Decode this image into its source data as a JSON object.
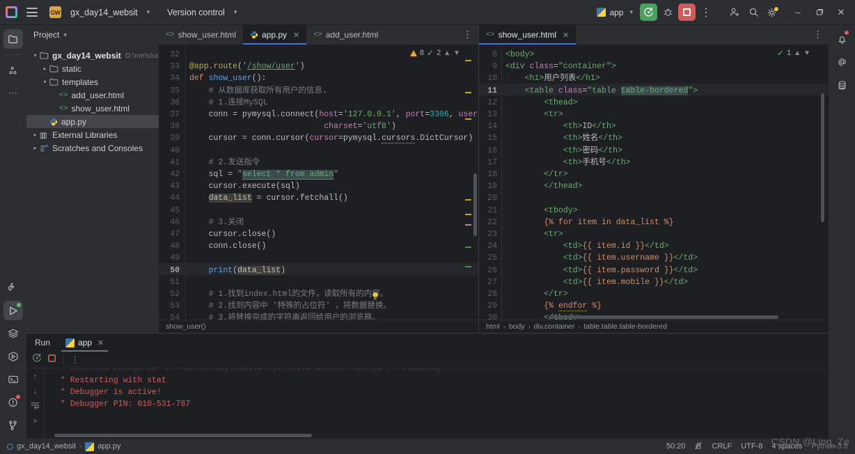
{
  "titlebar": {
    "project_badge": "GW",
    "project_name": "gx_day14_websit",
    "version_control": "Version control",
    "run_config": "app",
    "icons": {
      "menu": "hamburger-icon",
      "run": "run-icon",
      "debug": "debug-icon",
      "stop": "stop-icon",
      "more": "more-vertical-icon",
      "account": "user-add-icon",
      "search": "search-icon",
      "settings": "gear-icon",
      "minimize": "minimize-icon",
      "maximize": "maximize-icon",
      "close": "close-icon"
    }
  },
  "left_rail": [
    {
      "name": "project-tool-icon",
      "selected": true
    },
    {
      "name": "commit-tool-icon",
      "selected": false
    },
    {
      "name": "more-tools-icon",
      "selected": false
    },
    {
      "name": "python-packages-icon",
      "selected": false
    },
    {
      "name": "run-tool-icon",
      "selected": true,
      "badge": "green"
    },
    {
      "name": "database-layers-icon",
      "selected": false
    },
    {
      "name": "python-console-icon",
      "selected": false
    },
    {
      "name": "terminal-icon",
      "selected": false
    },
    {
      "name": "problems-icon",
      "selected": false,
      "badge": "red"
    },
    {
      "name": "version-control-icon",
      "selected": false
    }
  ],
  "right_rail": [
    {
      "name": "notifications-icon",
      "badge": "red"
    },
    {
      "name": "ai-assistant-icon"
    },
    {
      "name": "database-icon"
    }
  ],
  "project_panel": {
    "title": "Project",
    "tree": [
      {
        "indent": 0,
        "arrow": "v",
        "icon": "folder-icon",
        "label": "gx_day14_websit",
        "bold": true,
        "path": "D:\\me\\stud",
        "selected": false
      },
      {
        "indent": 1,
        "arrow": ">",
        "icon": "folder-icon",
        "label": "static",
        "bold": false,
        "path": "",
        "selected": false
      },
      {
        "indent": 1,
        "arrow": "v",
        "icon": "folder-icon",
        "label": "templates",
        "bold": false,
        "path": "",
        "selected": false
      },
      {
        "indent": 2,
        "arrow": "",
        "icon": "html-file-icon",
        "label": "add_user.html",
        "bold": false,
        "path": "",
        "selected": false
      },
      {
        "indent": 2,
        "arrow": "",
        "icon": "html-file-icon",
        "label": "show_user.html",
        "bold": false,
        "path": "",
        "selected": false
      },
      {
        "indent": 1,
        "arrow": "",
        "icon": "python-file-icon",
        "label": "app.py",
        "bold": false,
        "path": "",
        "selected": true
      },
      {
        "indent": 0,
        "arrow": ">",
        "icon": "library-icon",
        "label": "External Libraries",
        "bold": false,
        "path": "",
        "selected": false
      },
      {
        "indent": 0,
        "arrow": ">",
        "icon": "scratches-icon",
        "label": "Scratches and Consoles",
        "bold": false,
        "path": "",
        "selected": false
      }
    ]
  },
  "editor_left": {
    "tabs": [
      {
        "label": "show_user.html",
        "icon": "html-file-icon",
        "active": false,
        "closable": false
      },
      {
        "label": "app.py",
        "icon": "python-file-icon",
        "active": true,
        "closable": true
      },
      {
        "label": "add_user.html",
        "icon": "html-file-icon",
        "active": false,
        "closable": false
      }
    ],
    "inspection": {
      "warnings": "8",
      "checks": "2"
    },
    "breadcrumb": "show_user()",
    "current_line": 50,
    "lines": [
      {
        "no": "32",
        "html": "<span class=\"cm\"></span>"
      },
      {
        "no": "33",
        "html": "<span class=\"dec\">@app</span><span class=\"df\">.</span><span class=\"dec\">route</span><span class=\"df\">(</span><span class=\"st\">'</span><span class=\"underline-url\">/show/user</span><span class=\"st\">'</span><span class=\"df\">)</span>"
      },
      {
        "no": "34",
        "html": "<span class=\"k\">def</span> <span class=\"fn\">show_user</span><span class=\"df\">():</span>"
      },
      {
        "no": "35",
        "html": "    <span class=\"cm\"># 从数据库获取所有用户的信息.</span>"
      },
      {
        "no": "36",
        "html": "    <span class=\"cm\"># 1.连接MySQL</span>"
      },
      {
        "no": "37",
        "html": "    <span class=\"df\">conn = pymysql.connect(</span><span class=\"kw\">host</span><span class=\"df\">=</span><span class=\"st\">'127.0.0.1'</span><span class=\"df\">, </span><span class=\"kw\">port</span><span class=\"df\">=</span><span class=\"nu\">3306</span><span class=\"df\">, </span><span class=\"kw\">user</span><span class=\"df\">=</span><span class=\"st\">'roo</span>"
      },
      {
        "no": "38",
        "html": "                            <span class=\"kw\">charset</span><span class=\"df\">=</span><span class=\"st\">'utf8'</span><span class=\"df\">)</span>"
      },
      {
        "no": "39",
        "html": "    <span class=\"df\">cursor = conn.cursor(</span><span class=\"kw\">cursor</span><span class=\"df\">=pymysql.</span><span class=\"wavy\">cursors</span><span class=\"df\">.DictCursor)</span>"
      },
      {
        "no": "40",
        "html": ""
      },
      {
        "no": "41",
        "html": "    <span class=\"cm\"># 2.发送指令</span>"
      },
      {
        "no": "42",
        "html": "    <span class=\"df\">sql = </span><span class=\"st\">\"</span><span class=\"str-hl st wavy\">select * from admin</span><span class=\"st\">\"</span>"
      },
      {
        "no": "43",
        "html": "    <span class=\"df\">cursor.execute(sql)</span>"
      },
      {
        "no": "44",
        "html": "    <span class=\"occ-hl df\">data_list</span><span class=\"df\"> = cursor.fetchall()</span>"
      },
      {
        "no": "45",
        "html": ""
      },
      {
        "no": "46",
        "html": "    <span class=\"cm\"># 3.关闭</span>"
      },
      {
        "no": "47",
        "html": "    <span class=\"df\">cursor.close()</span>"
      },
      {
        "no": "48",
        "html": "    <span class=\"df\">conn.close()</span>"
      },
      {
        "no": "49",
        "html": ""
      },
      {
        "no": "50",
        "html": "    <span class=\"fn\">print</span><span class=\"df\">(</span><span class=\"occ-hl df\">data_list</span><span class=\"df\">)</span>"
      },
      {
        "no": "51",
        "html": ""
      },
      {
        "no": "52",
        "html": "    <span class=\"cm\"># 1.找到index.html的文件，读取所有的内容。</span>"
      },
      {
        "no": "53",
        "html": "    <span class=\"cm\"># 2.找到内容中 '特殊的占位符' ，将数据替换。</span>"
      },
      {
        "no": "54",
        "html": "    <span class=\"cm\"># 3.将替换完成的字符串返回给用户的浏览器。</span>"
      }
    ]
  },
  "editor_right": {
    "tabs": [
      {
        "label": "show_user.html",
        "icon": "html-file-icon",
        "active": true,
        "closable": true
      }
    ],
    "inspection": {
      "checks": "1"
    },
    "breadcrumb": [
      "html",
      "body",
      "div.container",
      "table.table.table-bordered"
    ],
    "current_line": 11,
    "lines": [
      {
        "no": "8",
        "html": "<span class=\"tg\">&lt;body&gt;</span>"
      },
      {
        "no": "9",
        "html": "<span class=\"tg\">&lt;div </span><span class=\"kw\">class</span><span class=\"df\">=</span><span class=\"st\">\"container\"</span><span class=\"tg\">&gt;</span>"
      },
      {
        "no": "10",
        "html": "    <span class=\"tg\">&lt;h1&gt;</span><span class=\"df\">用户列表</span><span class=\"tg\">&lt;/h1&gt;</span>"
      },
      {
        "no": "11",
        "html": "    <span class=\"tg\">&lt;table </span><span class=\"kw\">class</span><span class=\"df\">=</span><span class=\"st\">\"table </span><span class=\"str-hl st\">table-bordered</span><span class=\"st\">\"</span><span class=\"tg\">&gt;</span>"
      },
      {
        "no": "12",
        "html": "        <span class=\"tg\">&lt;thead&gt;</span>"
      },
      {
        "no": "13",
        "html": "        <span class=\"tg\">&lt;tr&gt;</span>"
      },
      {
        "no": "14",
        "html": "            <span class=\"tg\">&lt;th&gt;</span><span class=\"df\">ID</span><span class=\"tg\">&lt;/th&gt;</span>"
      },
      {
        "no": "15",
        "html": "            <span class=\"tg\">&lt;th&gt;</span><span class=\"df\">姓名</span><span class=\"tg\">&lt;/th&gt;</span>"
      },
      {
        "no": "16",
        "html": "            <span class=\"tg\">&lt;th&gt;</span><span class=\"df\">密码</span><span class=\"tg\">&lt;/th&gt;</span>"
      },
      {
        "no": "17",
        "html": "            <span class=\"tg\">&lt;th&gt;</span><span class=\"df\">手机号</span><span class=\"tg\">&lt;/th&gt;</span>"
      },
      {
        "no": "18",
        "html": "        <span class=\"tg\">&lt;/tr&gt;</span>"
      },
      {
        "no": "19",
        "html": "        <span class=\"tg\">&lt;/thead&gt;</span>"
      },
      {
        "no": "20",
        "html": ""
      },
      {
        "no": "21",
        "html": "        <span class=\"tg\">&lt;tbody&gt;</span>"
      },
      {
        "no": "22",
        "html": "        <span class=\"jj\">{% for item in data_list %}</span>"
      },
      {
        "no": "23",
        "html": "        <span class=\"tg\">&lt;tr&gt;</span>"
      },
      {
        "no": "24",
        "html": "            <span class=\"tg\">&lt;td&gt;</span><span class=\"jj\">{{ item.id }}</span><span class=\"tg\">&lt;/td&gt;</span>"
      },
      {
        "no": "25",
        "html": "            <span class=\"tg\">&lt;td&gt;</span><span class=\"jj\">{{ item.username }}</span><span class=\"tg\">&lt;/td&gt;</span>"
      },
      {
        "no": "26",
        "html": "            <span class=\"tg\">&lt;td&gt;</span><span class=\"jj\">{{ item.password }}</span><span class=\"tg\">&lt;/td&gt;</span>"
      },
      {
        "no": "27",
        "html": "            <span class=\"tg\">&lt;td&gt;</span><span class=\"jj\">{{ item.mobile }}</span><span class=\"tg\">&lt;/td&gt;</span>"
      },
      {
        "no": "28",
        "html": "        <span class=\"tg\">&lt;/tr&gt;</span>"
      },
      {
        "no": "29",
        "html": "        <span class=\"jj\">{% </span><span class=\"jj wavy\">endfor</span><span class=\"jj\"> %}</span>"
      },
      {
        "no": "30",
        "html": "        <span class=\"tg\">&lt;/tbody&gt;</span>"
      }
    ]
  },
  "run_panel": {
    "title": "Run",
    "tab": "app",
    "toolbar": {
      "rerun": "rerun-icon",
      "stop": "stop-icon",
      "more": "more-vertical-icon"
    },
    "gutter": {
      "up": "scroll-up-icon",
      "down": "scroll-down-icon",
      "wrap": "soft-wrap-icon",
      "prompt": "prompt-icon"
    },
    "console_lines": [
      " * Detected change in 'D:\\\\me\\\\study\\\\day14\\\\gx_day14_websit\\\\app.py', reloading",
      " * Restarting with stat",
      " * Debugger is active!",
      " * Debugger PIN: 610-531-787"
    ]
  },
  "status_bar": {
    "breadcrumb_project": "gx_day14_websit",
    "breadcrumb_file": "app.py",
    "caret": "50:20",
    "line_sep": "CRLF",
    "encoding": "UTF-8",
    "indent": "4 spaces",
    "python_version": "Python 3.8",
    "watermark": "CSDN @Ling_Ze"
  }
}
